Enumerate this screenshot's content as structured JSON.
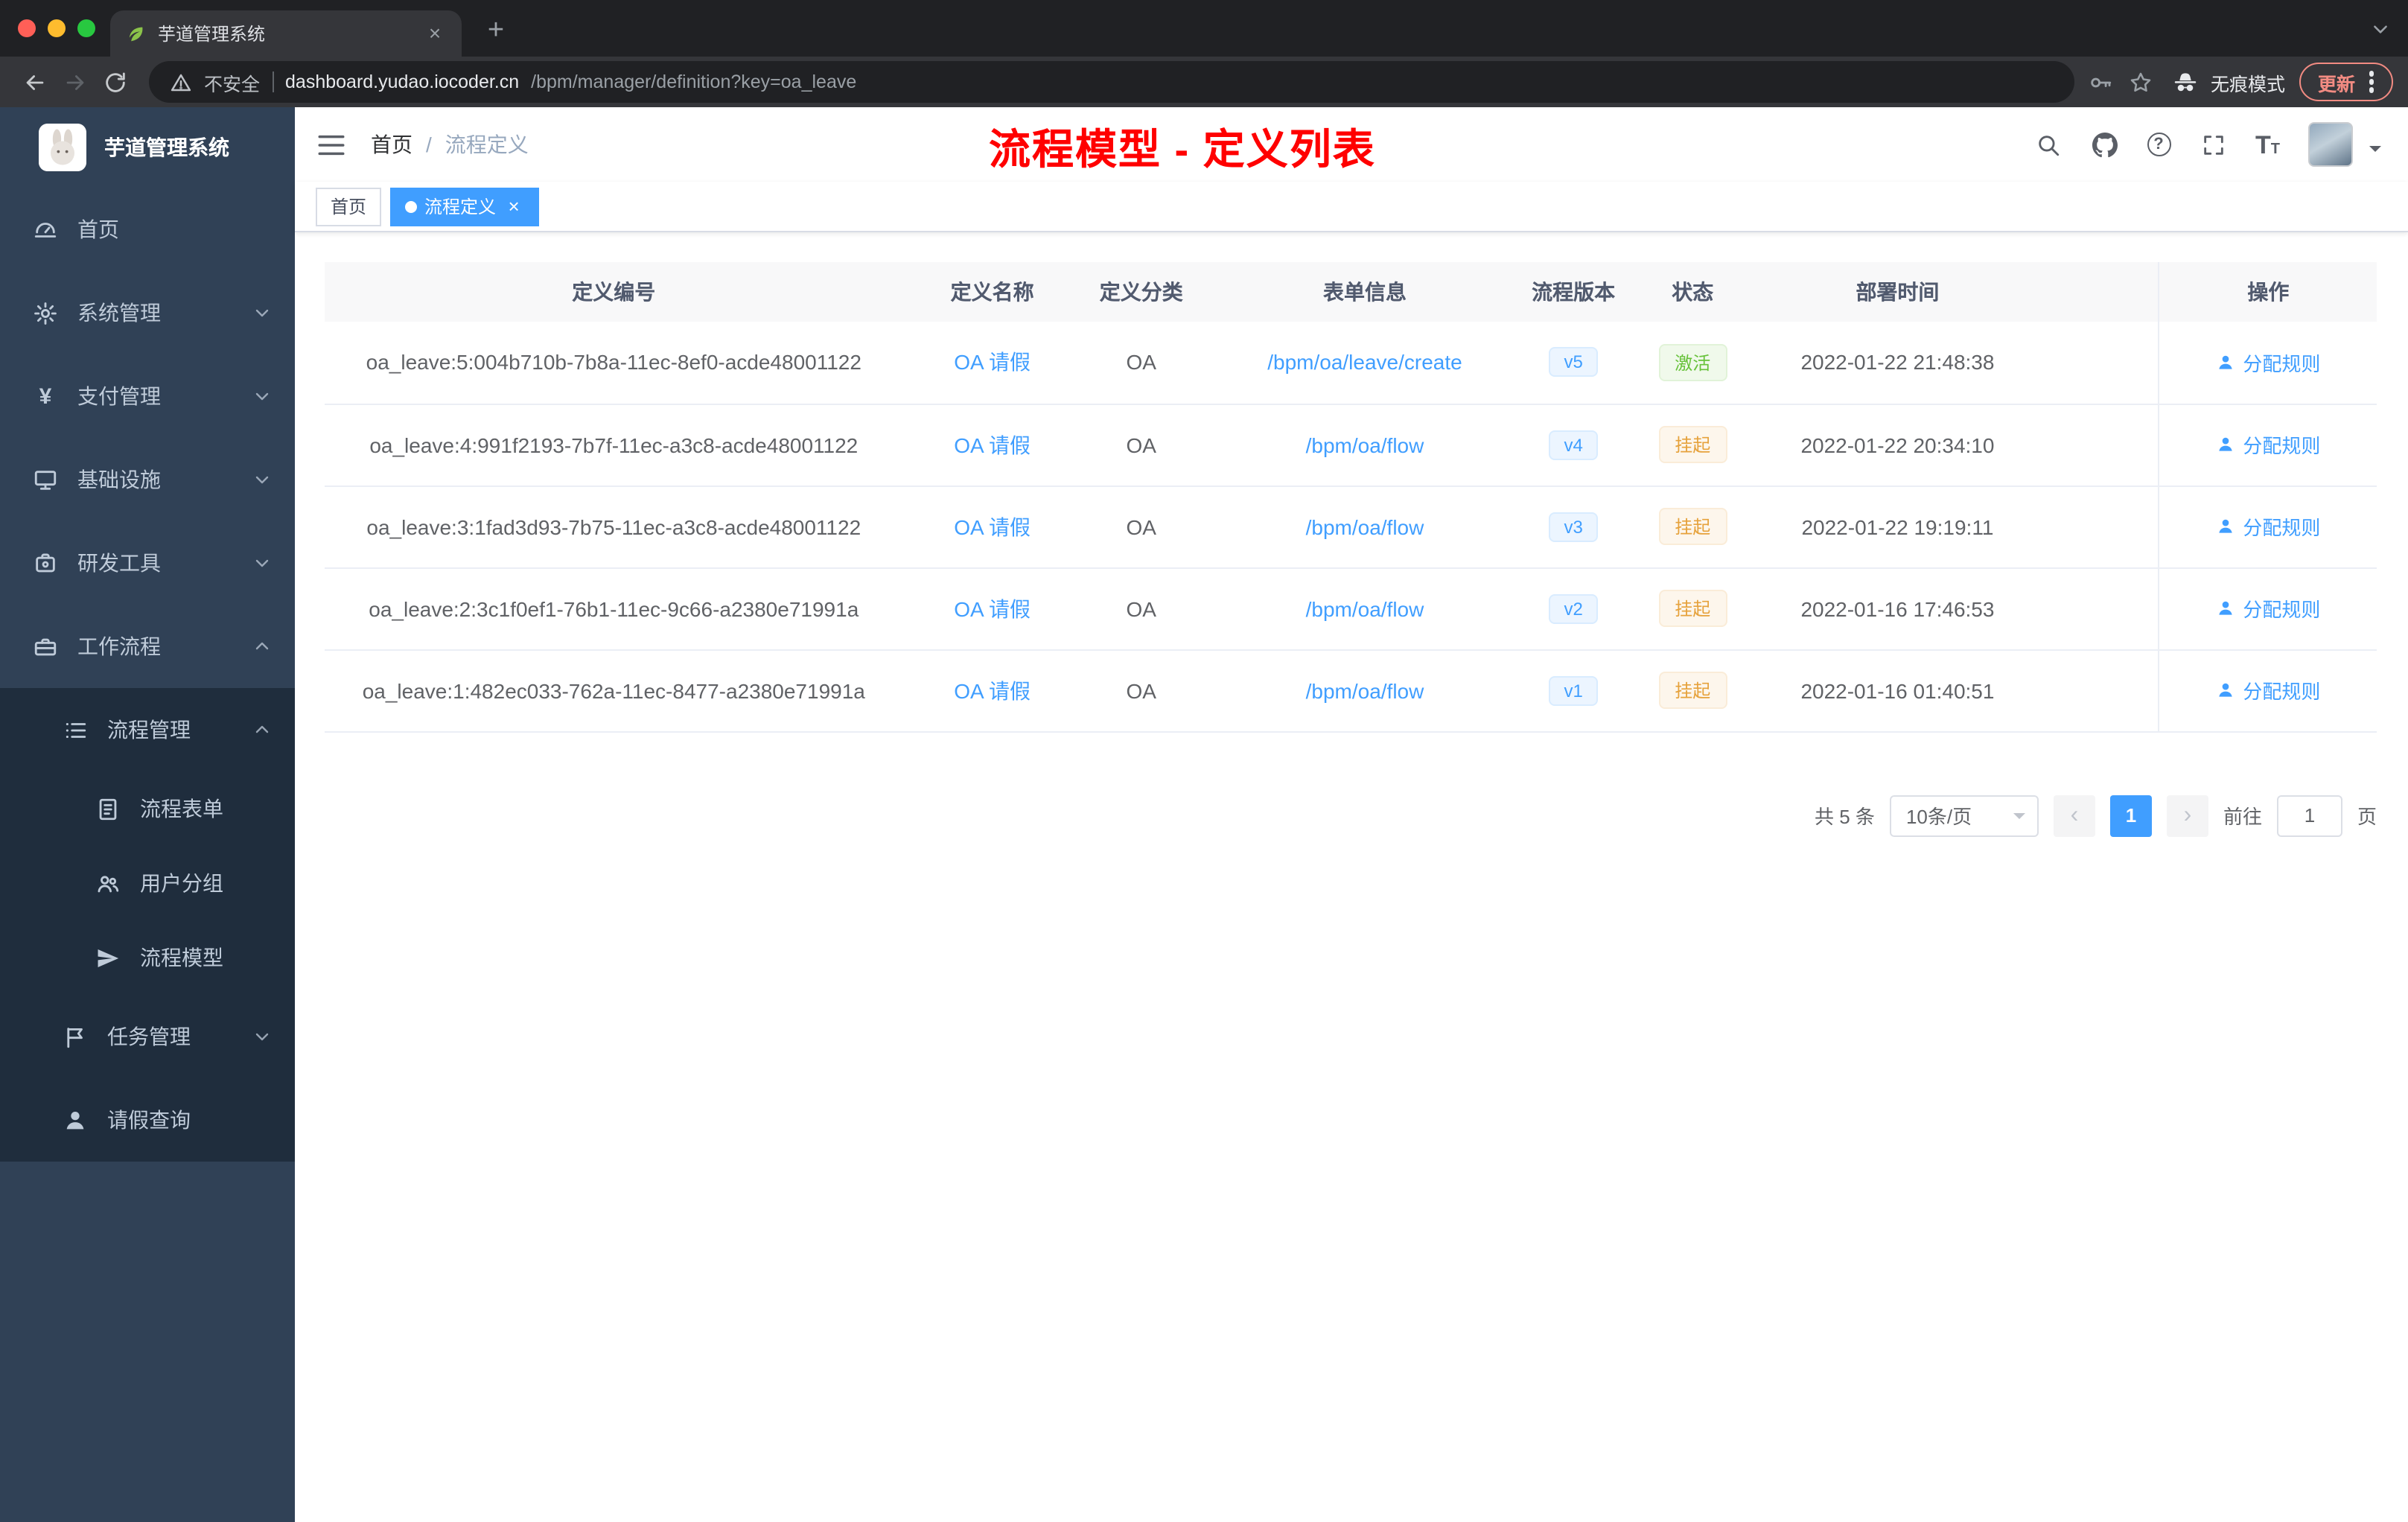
{
  "browser": {
    "tab_title": "芋道管理系统",
    "security_label": "不安全",
    "url_host": "dashboard.yudao.iocoder.cn",
    "url_path": "/bpm/manager/definition?key=oa_leave",
    "incognito_label": "无痕模式",
    "update_label": "更新"
  },
  "sidebar": {
    "app_title": "芋道管理系统",
    "items": [
      {
        "label": "首页"
      },
      {
        "label": "系统管理"
      },
      {
        "label": "支付管理"
      },
      {
        "label": "基础设施"
      },
      {
        "label": "研发工具"
      },
      {
        "label": "工作流程"
      },
      {
        "label": "流程管理"
      },
      {
        "label": "流程表单"
      },
      {
        "label": "用户分组"
      },
      {
        "label": "流程模型"
      },
      {
        "label": "任务管理"
      },
      {
        "label": "请假查询"
      }
    ]
  },
  "header": {
    "breadcrumb": [
      "首页",
      "流程定义"
    ],
    "breadcrumb_separator": "/",
    "annotation": "流程模型 - 定义列表"
  },
  "tags": [
    {
      "label": "首页"
    },
    {
      "label": "流程定义"
    }
  ],
  "table": {
    "columns": [
      "定义编号",
      "定义名称",
      "定义分类",
      "表单信息",
      "流程版本",
      "状态",
      "部署时间",
      "操作"
    ],
    "action_label": "分配规则",
    "rows": [
      {
        "id": "oa_leave:5:004b710b-7b8a-11ec-8ef0-acde48001122",
        "name": "OA 请假",
        "category": "OA",
        "form": "/bpm/oa/leave/create",
        "version": "v5",
        "status": "激活",
        "status_type": "success",
        "deploy_time": "2022-01-22 21:48:38"
      },
      {
        "id": "oa_leave:4:991f2193-7b7f-11ec-a3c8-acde48001122",
        "name": "OA 请假",
        "category": "OA",
        "form": "/bpm/oa/flow",
        "version": "v4",
        "status": "挂起",
        "status_type": "warning",
        "deploy_time": "2022-01-22 20:34:10"
      },
      {
        "id": "oa_leave:3:1fad3d93-7b75-11ec-a3c8-acde48001122",
        "name": "OA 请假",
        "category": "OA",
        "form": "/bpm/oa/flow",
        "version": "v3",
        "status": "挂起",
        "status_type": "warning",
        "deploy_time": "2022-01-22 19:19:11"
      },
      {
        "id": "oa_leave:2:3c1f0ef1-76b1-11ec-9c66-a2380e71991a",
        "name": "OA 请假",
        "category": "OA",
        "form": "/bpm/oa/flow",
        "version": "v2",
        "status": "挂起",
        "status_type": "warning",
        "deploy_time": "2022-01-16 17:46:53"
      },
      {
        "id": "oa_leave:1:482ec033-762a-11ec-8477-a2380e71991a",
        "name": "OA 请假",
        "category": "OA",
        "form": "/bpm/oa/flow",
        "version": "v1",
        "status": "挂起",
        "status_type": "warning",
        "deploy_time": "2022-01-16 01:40:51"
      }
    ]
  },
  "pagination": {
    "total_label": "共 5 条",
    "page_size_label": "10条/页",
    "current_page": "1",
    "goto_label": "前往",
    "goto_value": "1",
    "unit_label": "页"
  },
  "colors": {
    "accent": "#409eff",
    "success": "#67c23a",
    "warning": "#e6a23c",
    "annotation": "#ff0000",
    "sidebar_bg": "#304156",
    "submenu_bg": "#1f2d3d"
  }
}
